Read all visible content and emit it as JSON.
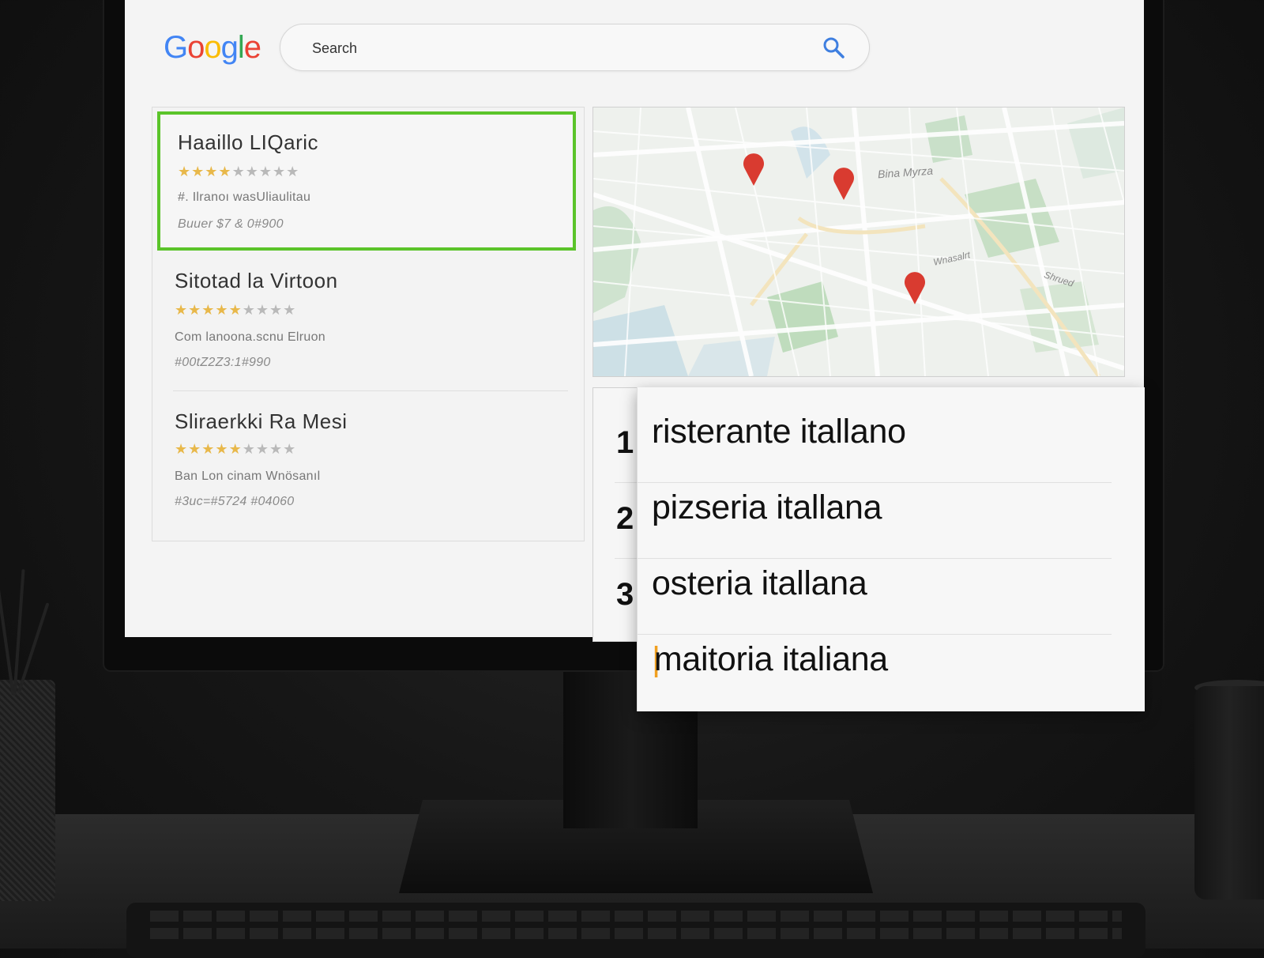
{
  "logo": {
    "letters": [
      {
        "ch": "G",
        "color": "#4285F4"
      },
      {
        "ch": "o",
        "color": "#EA4335"
      },
      {
        "ch": "o",
        "color": "#FBBC05"
      },
      {
        "ch": "g",
        "color": "#4285F4"
      },
      {
        "ch": "l",
        "color": "#34A853"
      },
      {
        "ch": "e",
        "color": "#EA4335"
      }
    ]
  },
  "search": {
    "placeholder": "Search",
    "icon": "search-icon"
  },
  "results": [
    {
      "title": "Haaillo LIQaric",
      "rating": 3.5,
      "max_rating": 5,
      "line1": "#. Ilranoı wasUliaulitau",
      "line2": "Buuer $7 & 0#900",
      "selected": true
    },
    {
      "title": "Sitotad la Virtoon",
      "rating": 5,
      "max_rating": 5,
      "line1": "Com lanoona.scnu Elruon",
      "line2": "#00tZ2Z3:1#990",
      "selected": false
    },
    {
      "title": "Sliraerkki Ra Mesi",
      "rating": 5,
      "max_rating": 5,
      "line1": "Ban Lon cinam Wnösanıl",
      "line2": "#3uc=#5724 #04060",
      "selected": false
    }
  ],
  "map": {
    "labels": [
      "Bina Myrza",
      "Wnasalrt",
      "Shrued"
    ],
    "pins": [
      {
        "name": "pin-1"
      },
      {
        "name": "pin-2"
      },
      {
        "name": "pin-3"
      }
    ],
    "pin_color": "#D93B30"
  },
  "suggestions": {
    "numbers": [
      "1",
      "2",
      "3"
    ],
    "items": [
      {
        "text": "risterante itallano"
      },
      {
        "text": "pizseria itallana"
      },
      {
        "text": "osteria itallana"
      },
      {
        "text": "maitoria italiana",
        "caret_prefix": ""
      }
    ],
    "caret_color": "#F0A020"
  },
  "colors": {
    "selected_border": "#5BC42A",
    "star_on": "#E8B84A",
    "star_off": "#B9B9B9"
  }
}
